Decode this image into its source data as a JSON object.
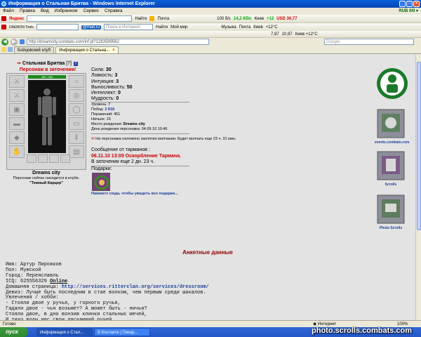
{
  "window": {
    "title": "Информация о Стальная Бритва - Windows Internet Explorer"
  },
  "menu": {
    "items": [
      "Файл",
      "Правка",
      "Вид",
      "Избранное",
      "Сервис",
      "Справка"
    ],
    "right": "RUB 0/0 ▾"
  },
  "toolbar1": {
    "brand": "Яндекс",
    "search_btn": "Найти",
    "mail": "Почта",
    "weather_low": "100 б/с",
    "speed": "14,2 Кб/с",
    "city": "Киев",
    "temp": "+12",
    "usd": "USD 30,77"
  },
  "toolbar2": {
    "brand": "DAEMON Tools",
    "mailru": "@mail.ru",
    "search_placeholder": "Поиск в Интернет",
    "search_btn": "Найти",
    "myworld": "Мой мир",
    "music": "Музыка",
    "mail": "Почта",
    "city": "Киев",
    "temp": "+12°C"
  },
  "toolbar3": {
    "quote1": "7,97",
    "quote2": "10,97",
    "quote3": "Киев +12°C"
  },
  "address": {
    "url": "http://dreamcity.combats.com/inf.pl?1283589562",
    "search_placeholder": "Google"
  },
  "tabs": [
    {
      "label": "Бойцовский клуб"
    },
    {
      "label": "Информация о Стальна..."
    }
  ],
  "character": {
    "name": "Стальная Бритва",
    "level": "[7]",
    "info_icon": "i",
    "prison_title": "Персонаж в заточении!",
    "hp": "460 / 460",
    "city": "Dreams city",
    "location_text": "Персонаж сейчас находится в клубе.",
    "location_place": "\"Темный Карцер\""
  },
  "stats": [
    {
      "label": "Сила:",
      "value": "30"
    },
    {
      "label": "Ловкость:",
      "value": "3"
    },
    {
      "label": "Интуиция:",
      "value": "3"
    },
    {
      "label": "Выносливость:",
      "value": "50"
    },
    {
      "label": "Интеллект:",
      "value": "0"
    },
    {
      "label": "Мудрость:",
      "value": "0"
    }
  ],
  "info": [
    {
      "label": "Уровень:",
      "value": "7"
    },
    {
      "label": "Побед:",
      "value": "2 818"
    },
    {
      "label": "Поражений:",
      "value": "451"
    },
    {
      "label": "Ничьих:",
      "value": "16"
    },
    {
      "label": "Место рождения:",
      "value": "Dreams city"
    },
    {
      "label": "День рождения персонажа:",
      "value": "04.09.10 10:46"
    }
  ],
  "spell_text": "На персонажа наложено заклятие молчания. Будет молчать еще 23 ч. 31 мин.",
  "message": {
    "header": "Сообщение от тарманов :",
    "text": "06.11.10 13:09 Оскорбление Тармана.",
    "prison": "В заточении еще 2 дн. 23 ч."
  },
  "gifts": {
    "label": "Подарки:",
    "link": "Нажмите сюда, чтобы увидеть все подарки..."
  },
  "right_icons": [
    {
      "label": ""
    },
    {
      "label": "events.combats.com"
    },
    {
      "label": "Scrolls"
    },
    {
      "label": "Photo Scrolls"
    }
  ],
  "profile": {
    "title": "Анкетные данные",
    "name": "Имя: Артур Пирожков",
    "sex": "Пол: Мужской",
    "city": "Город: Переяславль",
    "icq": "ICQ: 625556329",
    "online": "Online",
    "homepage_label": "Домашняя страница:",
    "homepage_url": "http://services.ritterclan.org/services/dressroom/",
    "motto": "Девиз: Лучше быть последним в стае волком, чем первым среди шакалов.",
    "hobby_label": "Увлечения / хобби:",
    "poem": [
      "- Стояли двое у ручья, у горного ручья,",
      "Гадали двое - чья возьмет? А может быть - ничья?",
      "Стояли двое, в дно вонзив клинки стальных мечей,",
      "И тихо воды нес свои ласкающий ручей"
    ]
  },
  "status": {
    "left": "Готово",
    "zone": "Интернет",
    "zoom": "100%"
  },
  "taskbar": {
    "start": "пуск",
    "tasks": [
      "Информация о Стал...",
      "В Контакте | Пикар..."
    ],
    "watermark": "photo.scrolls.combats.com"
  },
  "colors": {
    "accent_red": "#cc0000",
    "link_blue": "#1b3f9c",
    "profile_title": "#8b0000",
    "hp_green": "#1c8a1c"
  }
}
